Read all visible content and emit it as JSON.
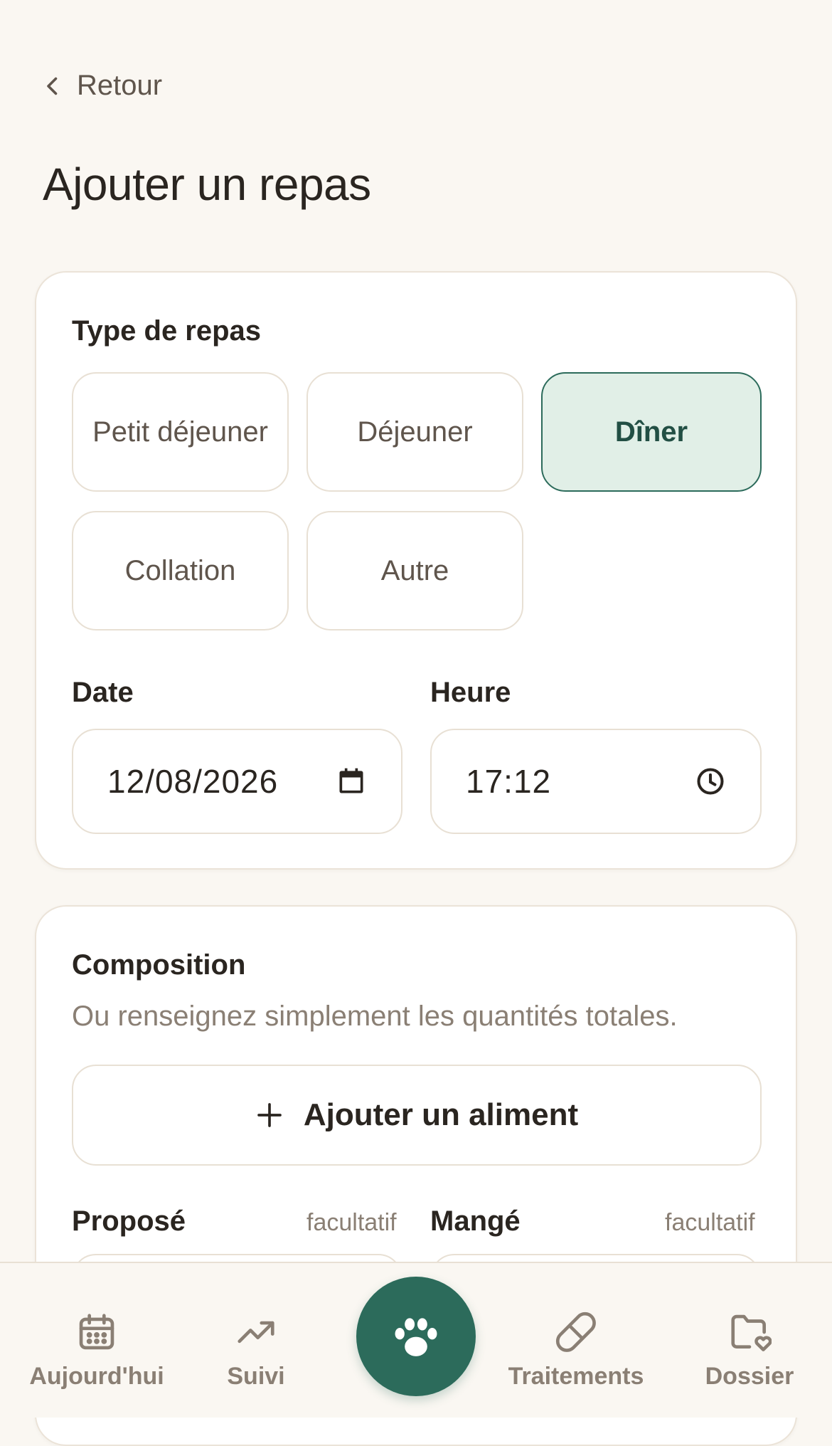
{
  "header": {
    "back_label": "Retour",
    "title": "Ajouter un repas"
  },
  "meal_type": {
    "label": "Type de repas",
    "options": [
      {
        "label": "Petit déjeuner",
        "selected": false
      },
      {
        "label": "Déjeuner",
        "selected": false
      },
      {
        "label": "Dîner",
        "selected": true
      },
      {
        "label": "Collation",
        "selected": false
      },
      {
        "label": "Autre",
        "selected": false
      }
    ]
  },
  "date": {
    "label": "Date",
    "value": "12/08/2026"
  },
  "time": {
    "label": "Heure",
    "value": "17:12"
  },
  "composition": {
    "title": "Composition",
    "subtitle": "Ou renseignez simplement les quantités totales.",
    "add_food_label": "Ajouter un aliment",
    "proposed_label": "Proposé",
    "eaten_label": "Mangé",
    "optional_label": "facultatif"
  },
  "nav": {
    "items": [
      {
        "label": "Aujourd'hui",
        "icon": "calendar-icon"
      },
      {
        "label": "Suivi",
        "icon": "trending-up-icon"
      },
      {
        "label": "",
        "icon": "paw-icon"
      },
      {
        "label": "Traitements",
        "icon": "pill-icon"
      },
      {
        "label": "Dossier",
        "icon": "folder-heart-icon"
      }
    ]
  },
  "colors": {
    "background": "#FAF7F2",
    "accent": "#2C6B5B",
    "selected_bg": "#E1EFE7",
    "text": "#2A2520",
    "muted": "#8A7F74",
    "border": "#E8E0D4"
  }
}
